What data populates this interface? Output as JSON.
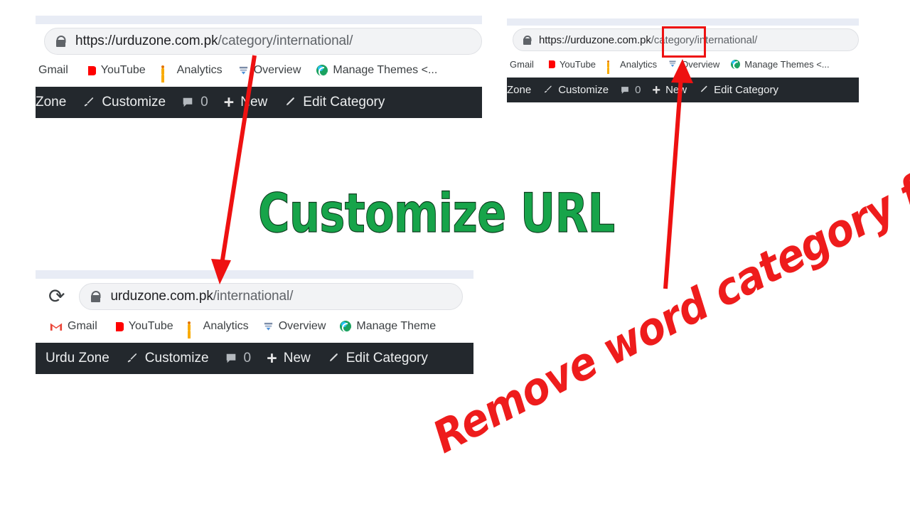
{
  "panels": [
    {
      "id": "panel-before-top-left",
      "omnibox": {
        "lock_icon": "lock-icon",
        "url_domain": "https://urduzone.com.pk",
        "url_path": "/category/international/",
        "url_full": "https://urduzone.com.pk/category/international/",
        "reload_icon": ""
      },
      "bookmarks": [
        {
          "icon": "gmail-icon",
          "label": "Gmail"
        },
        {
          "icon": "youtube-icon",
          "label": "YouTube"
        },
        {
          "icon": "analytics-icon",
          "label": "Analytics"
        },
        {
          "icon": "overview-icon",
          "label": "Overview"
        },
        {
          "icon": "manage-themes-icon",
          "label": "Manage Themes <..."
        }
      ],
      "adminbar": [
        {
          "icon": "",
          "label": "Zone"
        },
        {
          "icon": "brush-icon",
          "label": "Customize"
        },
        {
          "icon": "comment-icon",
          "label": "0"
        },
        {
          "icon": "plus-icon",
          "label": "New"
        },
        {
          "icon": "pencil-icon",
          "label": "Edit Category"
        }
      ]
    },
    {
      "id": "panel-before-top-right",
      "omnibox": {
        "lock_icon": "lock-icon",
        "url_domain": "https://urduzone.com.pk",
        "url_path": "/category/international/",
        "url_full": "https://urduzone.com.pk/category/international/",
        "reload_icon": ""
      },
      "bookmarks": [
        {
          "icon": "gmail-icon",
          "label": "Gmail"
        },
        {
          "icon": "youtube-icon",
          "label": "YouTube"
        },
        {
          "icon": "analytics-icon",
          "label": "Analytics"
        },
        {
          "icon": "overview-icon",
          "label": "Overview"
        },
        {
          "icon": "manage-themes-icon",
          "label": "Manage Themes <..."
        }
      ],
      "adminbar": [
        {
          "icon": "",
          "label": "Zone"
        },
        {
          "icon": "brush-icon",
          "label": "Customize"
        },
        {
          "icon": "comment-icon",
          "label": "0"
        },
        {
          "icon": "plus-icon",
          "label": "New"
        },
        {
          "icon": "pencil-icon",
          "label": "Edit Category"
        }
      ]
    },
    {
      "id": "panel-after-bottom-left",
      "omnibox": {
        "lock_icon": "lock-icon",
        "url_domain": "urduzone.com.pk",
        "url_path": "/international/",
        "url_full": "urduzone.com.pk/international/",
        "reload_icon": "⟳"
      },
      "bookmarks": [
        {
          "icon": "gmail-icon",
          "label": "Gmail"
        },
        {
          "icon": "youtube-icon",
          "label": "YouTube"
        },
        {
          "icon": "analytics-icon",
          "label": "Analytics"
        },
        {
          "icon": "overview-icon",
          "label": "Overview"
        },
        {
          "icon": "manage-themes-icon",
          "label": "Manage Theme"
        }
      ],
      "adminbar": [
        {
          "icon": "",
          "label": "Urdu Zone"
        },
        {
          "icon": "brush-icon",
          "label": "Customize"
        },
        {
          "icon": "comment-icon",
          "label": "0"
        },
        {
          "icon": "plus-icon",
          "label": "New"
        },
        {
          "icon": "pencil-icon",
          "label": "Edit Category"
        }
      ]
    }
  ],
  "annotations": {
    "green_title": "Customize URL",
    "red_caption": "Remove word category from URL",
    "highlight_word": "category",
    "colors": {
      "green": "#17a44a",
      "red": "#ee1c1c",
      "adminbar": "#23282d",
      "omnibox_fill": "#f2f3f5"
    }
  }
}
